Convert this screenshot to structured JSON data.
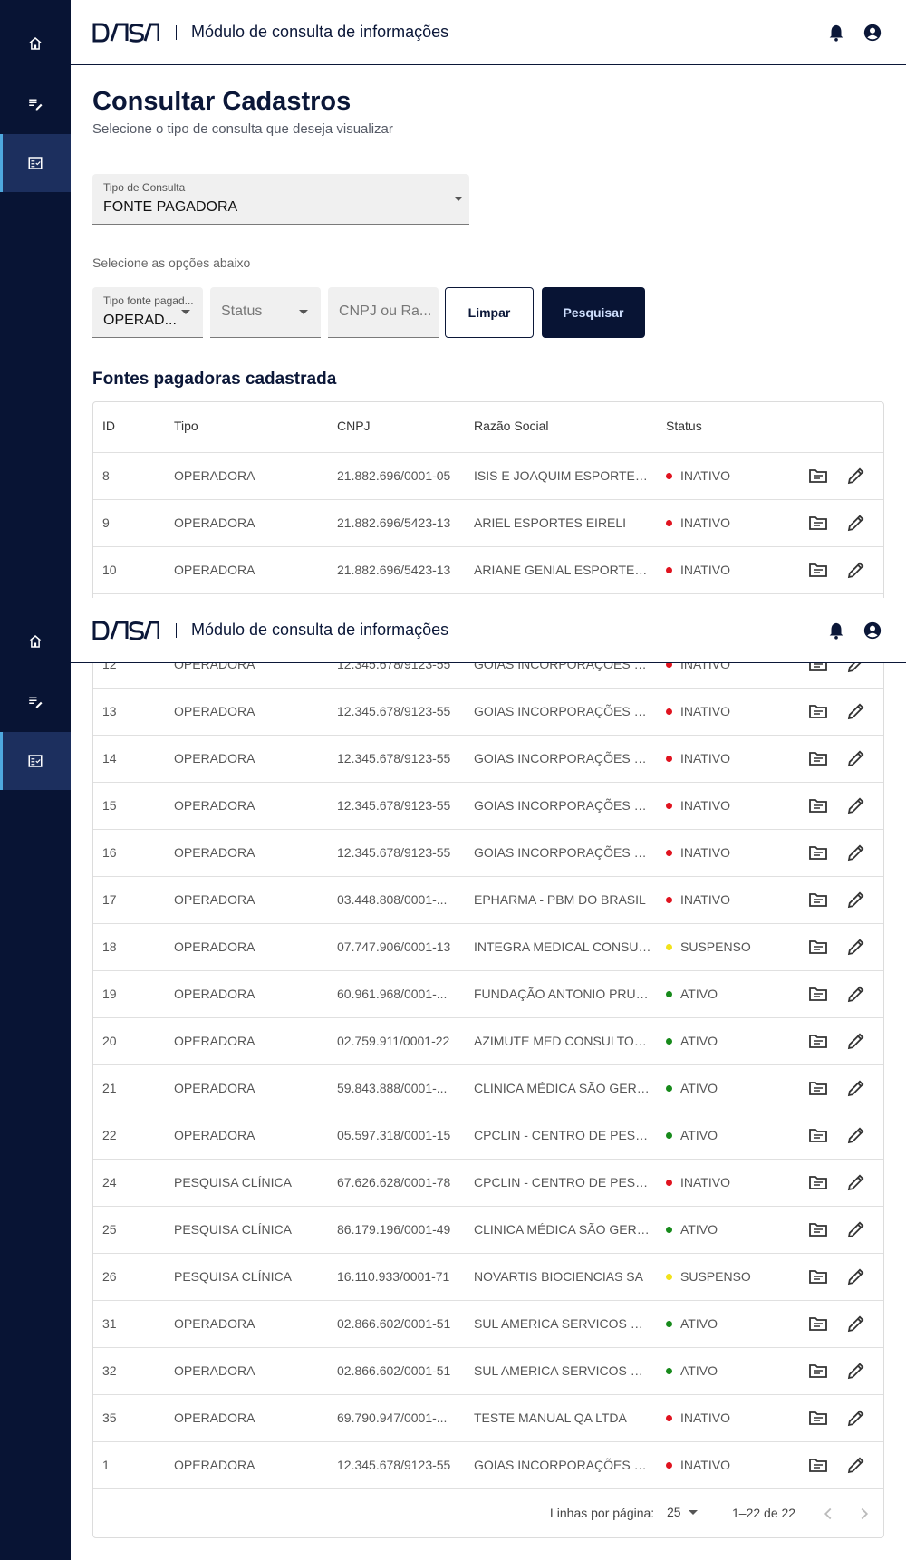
{
  "app": {
    "title": "Módulo de consulta de informações",
    "logo_text": "DASA"
  },
  "sidebar": {
    "items": [
      {
        "icon": "home-icon"
      },
      {
        "icon": "edit-list-icon"
      },
      {
        "icon": "checklist-icon",
        "active": true
      }
    ]
  },
  "header_icons": [
    "bell-icon",
    "account-circle-icon"
  ],
  "page": {
    "title": "Consultar Cadastros",
    "subtitle": "Selecione o tipo de consulta que deseja visualizar"
  },
  "tipo_consulta": {
    "label": "Tipo de Consulta",
    "value": "FONTE PAGADORA"
  },
  "filters": {
    "hint": "Selecione as opções abaixo",
    "tipo_fonte": {
      "label": "Tipo fonte pagad...",
      "value": "OPERAD..."
    },
    "status": {
      "placeholder": "Status"
    },
    "cnpj": {
      "placeholder": "CNPJ ou Ra..."
    },
    "clear_label": "Limpar",
    "search_label": "Pesquisar"
  },
  "table": {
    "title": "Fontes pagadoras cadastrada",
    "columns": [
      "ID",
      "Tipo",
      "CNPJ",
      "Razão Social",
      "Status"
    ],
    "rows_top": [
      {
        "id": "8",
        "tipo": "OPERADORA",
        "cnpj": "21.882.696/0001-05",
        "razao": "ISIS E JOAQUIM ESPORTES L...",
        "status": "INATIVO"
      },
      {
        "id": "9",
        "tipo": "OPERADORA",
        "cnpj": "21.882.696/5423-13",
        "razao": "ARIEL ESPORTES EIRELI",
        "status": "INATIVO"
      },
      {
        "id": "10",
        "tipo": "OPERADORA",
        "cnpj": "21.882.696/5423-13",
        "razao": "ARIANE GENIAL ESPORTES ...",
        "status": "INATIVO"
      }
    ],
    "row_partial": {
      "id": "12",
      "tipo": "OPERADORA",
      "cnpj": "12.345.678/9123-55",
      "razao": "GOIAS INCORPORAÇÕES LT...",
      "status": "INATIVO"
    },
    "rows_bottom": [
      {
        "id": "13",
        "tipo": "OPERADORA",
        "cnpj": "12.345.678/9123-55",
        "razao": "GOIAS INCORPORAÇÕES LT...",
        "status": "INATIVO"
      },
      {
        "id": "14",
        "tipo": "OPERADORA",
        "cnpj": "12.345.678/9123-55",
        "razao": "GOIAS INCORPORAÇÕES LT...",
        "status": "INATIVO"
      },
      {
        "id": "15",
        "tipo": "OPERADORA",
        "cnpj": "12.345.678/9123-55",
        "razao": "GOIAS INCORPORAÇÕES LT...",
        "status": "INATIVO"
      },
      {
        "id": "16",
        "tipo": "OPERADORA",
        "cnpj": "12.345.678/9123-55",
        "razao": "GOIAS INCORPORAÇÕES LT...",
        "status": "INATIVO"
      },
      {
        "id": "17",
        "tipo": "OPERADORA",
        "cnpj": "03.448.808/0001-...",
        "razao": "EPHARMA - PBM DO BRASIL",
        "status": "INATIVO"
      },
      {
        "id": "18",
        "tipo": "OPERADORA",
        "cnpj": "07.747.906/0001-13",
        "razao": "INTEGRA MEDICAL CONSUL...",
        "status": "SUSPENSO"
      },
      {
        "id": "19",
        "tipo": "OPERADORA",
        "cnpj": "60.961.968/0001-...",
        "razao": "FUNDAÇÃO ANTONIO PRUD...",
        "status": "ATIVO"
      },
      {
        "id": "20",
        "tipo": "OPERADORA",
        "cnpj": "02.759.911/0001-22",
        "razao": "AZIMUTE MED CONSULTORI...",
        "status": "ATIVO"
      },
      {
        "id": "21",
        "tipo": "OPERADORA",
        "cnpj": "59.843.888/0001-...",
        "razao": "CLINICA MÉDICA SÃO GERM...",
        "status": "ATIVO"
      },
      {
        "id": "22",
        "tipo": "OPERADORA",
        "cnpj": "05.597.318/0001-15",
        "razao": "CPCLIN - CENTRO DE PESQ...",
        "status": "ATIVO"
      },
      {
        "id": "24",
        "tipo": "PESQUISA CLÍNICA",
        "cnpj": "67.626.628/0001-78",
        "razao": "CPCLIN - CENTRO DE PESQ...",
        "status": "INATIVO"
      },
      {
        "id": "25",
        "tipo": "PESQUISA CLÍNICA",
        "cnpj": "86.179.196/0001-49",
        "razao": "CLINICA MÉDICA SÃO GERM...",
        "status": "ATIVO"
      },
      {
        "id": "26",
        "tipo": "PESQUISA CLÍNICA",
        "cnpj": "16.110.933/0001-71",
        "razao": "NOVARTIS BIOCIENCIAS SA",
        "status": "SUSPENSO"
      },
      {
        "id": "31",
        "tipo": "OPERADORA",
        "cnpj": "02.866.602/0001-51",
        "razao": "SUL AMERICA SERVICOS DE...",
        "status": "ATIVO"
      },
      {
        "id": "32",
        "tipo": "OPERADORA",
        "cnpj": "02.866.602/0001-51",
        "razao": "SUL AMERICA SERVICOS DE...",
        "status": "ATIVO"
      },
      {
        "id": "35",
        "tipo": "OPERADORA",
        "cnpj": "69.790.947/0001-...",
        "razao": "TESTE MANUAL QA LTDA",
        "status": "INATIVO"
      },
      {
        "id": "1",
        "tipo": "OPERADORA",
        "cnpj": "12.345.678/9123-55",
        "razao": "GOIAS INCORPORAÇÕES LT...",
        "status": "INATIVO"
      }
    ],
    "row_icons": [
      "folder-open-icon",
      "pencil-edit-icon"
    ]
  },
  "pagination": {
    "rows_per_page_label": "Linhas por página:",
    "rows_per_page_value": "25",
    "range": "1–22 de 22"
  },
  "status_colors": {
    "INATIVO": "#e0131f",
    "ATIVO": "#178a1b",
    "SUSPENSO": "#f2e21a"
  },
  "theme": {
    "sidebar_bg": "#081434",
    "primary": "#081434",
    "active_indicator": "#4ea8de"
  }
}
